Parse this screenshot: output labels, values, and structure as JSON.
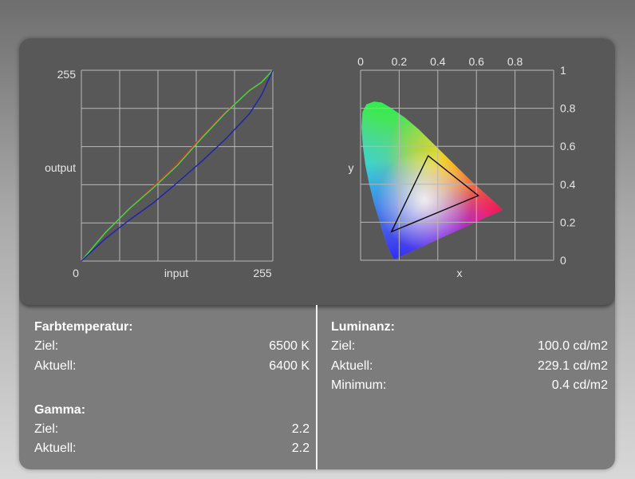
{
  "colors": {
    "page_bg_top": "#6e6e6e",
    "panel_bg": "#585858",
    "stats_bg": "#7c7c7c",
    "grid": "#b8b8b8",
    "text": "#ffffff",
    "axis_text": "#e6e6e6",
    "red_curve": "#d03030",
    "green_curve": "#40e040",
    "blue_curve": "#2020b0"
  },
  "chart_data": [
    {
      "type": "line",
      "xlabel": "input",
      "ylabel": "output",
      "xlim": [
        0,
        255
      ],
      "ylim": [
        0,
        255
      ],
      "x_tick_labels": [
        "0",
        "255"
      ],
      "y_tick_labels": [
        "255"
      ],
      "grid": true,
      "series": [
        {
          "color": "#d03030",
          "x": [
            0,
            32,
            64,
            96,
            128,
            160,
            192,
            224,
            240,
            255
          ],
          "y": [
            0,
            38,
            70,
            100,
            131,
            166,
            199,
            228,
            238,
            255
          ]
        },
        {
          "color": "#40e040",
          "x": [
            0,
            32,
            64,
            96,
            128,
            160,
            192,
            224,
            240,
            255
          ],
          "y": [
            0,
            38,
            70,
            98,
            128,
            164,
            198,
            228,
            239,
            255
          ]
        },
        {
          "color": "#2020b0",
          "x": [
            0,
            32,
            64,
            96,
            128,
            160,
            192,
            224,
            240,
            255
          ],
          "y": [
            0,
            30,
            55,
            78,
            105,
            133,
            163,
            197,
            222,
            255
          ]
        }
      ]
    },
    {
      "type": "scatter",
      "subtype": "cie-1931-chromaticity",
      "xlabel": "x",
      "ylabel": "y",
      "xlim": [
        0,
        1
      ],
      "ylim": [
        0,
        1
      ],
      "x_tick_labels": [
        "0",
        "0.2",
        "0.4",
        "0.6",
        "0.8"
      ],
      "y_tick_labels": [
        "1",
        "0.8",
        "0.6",
        "0.4",
        "0.2",
        "0"
      ],
      "x_axis_position": "top",
      "y_axis_position": "right",
      "grid": true,
      "gamut_triangle": [
        {
          "x": 0.35,
          "y": 0.55
        },
        {
          "x": 0.61,
          "y": 0.34
        },
        {
          "x": 0.16,
          "y": 0.15
        }
      ]
    }
  ],
  "farbtemperatur": {
    "title": "Farbtemperatur:",
    "ziel_label": "Ziel:",
    "ziel_value": "6500 K",
    "aktuell_label": "Aktuell:",
    "aktuell_value": "6400 K"
  },
  "gamma": {
    "title": "Gamma:",
    "ziel_label": "Ziel:",
    "ziel_value": "2.2",
    "aktuell_label": "Aktuell:",
    "aktuell_value": "2.2"
  },
  "luminanz": {
    "title": "Luminanz:",
    "ziel_label": "Ziel:",
    "ziel_value": "100.0 cd/m2",
    "aktuell_label": "Aktuell:",
    "aktuell_value": "229.1 cd/m2",
    "minimum_label": "Minimum:",
    "minimum_value": "0.4 cd/m2"
  }
}
